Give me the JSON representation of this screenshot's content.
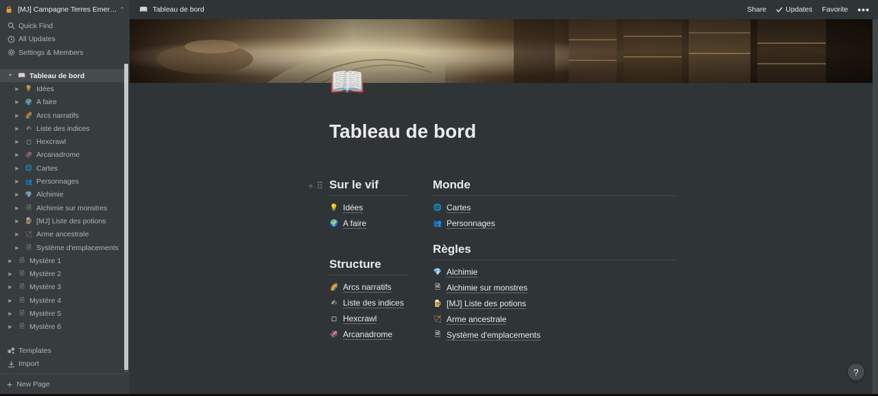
{
  "sidebar": {
    "workspace_name": "[MJ] Campagne Terres Emer…",
    "links": [
      {
        "icon": "search-icon",
        "label": "Quick Find"
      },
      {
        "icon": "clock-icon",
        "label": "All Updates"
      },
      {
        "icon": "gear-icon",
        "label": "Settings & Members"
      }
    ],
    "tree": [
      {
        "icon": "📖",
        "label": "Tableau de bord",
        "level": 0,
        "active": true,
        "expanded": true
      },
      {
        "icon": "💡",
        "label": "Idées",
        "level": 1
      },
      {
        "icon": "🌍",
        "label": "A faire",
        "level": 1
      },
      {
        "icon": "🌈",
        "label": "Arcs narratifs",
        "level": 1
      },
      {
        "icon": "✍",
        "label": "Liste des indices",
        "level": 1
      },
      {
        "icon": "◻",
        "label": "Hexcrawl",
        "level": 1
      },
      {
        "icon": "🦑",
        "label": "Arcanadrome",
        "level": 1
      },
      {
        "icon": "🌐",
        "label": "Cartes",
        "level": 1
      },
      {
        "icon": "👥",
        "label": "Personnages",
        "level": 1
      },
      {
        "icon": "💎",
        "label": "Alchimie",
        "level": 1
      },
      {
        "icon": "🗎",
        "label": "Alchimie sur monstres",
        "level": 1
      },
      {
        "icon": "🍺",
        "label": "[MJ] Liste des potions",
        "level": 1
      },
      {
        "icon": "🏹",
        "label": "Arme ancestrale",
        "level": 1
      },
      {
        "icon": "🗎",
        "label": "Système d'emplacements",
        "level": 1
      },
      {
        "icon": "🗎",
        "label": "Mystère 1",
        "level": 0
      },
      {
        "icon": "🗎",
        "label": "Mystère 2",
        "level": 0
      },
      {
        "icon": "🗎",
        "label": "Mystère 3",
        "level": 0
      },
      {
        "icon": "🗎",
        "label": "Mystère 4",
        "level": 0
      },
      {
        "icon": "🗎",
        "label": "Mystère 5",
        "level": 0
      },
      {
        "icon": "🗎",
        "label": "Mystère 6",
        "level": 0
      }
    ],
    "bottom_links": [
      {
        "icon": "templates-icon",
        "label": "Templates"
      },
      {
        "icon": "import-icon",
        "label": "Import"
      }
    ],
    "new_page_label": "New Page"
  },
  "topbar": {
    "breadcrumb_icon": "📖",
    "breadcrumb": "Tableau de bord",
    "share": "Share",
    "updates": "Updates",
    "favorite": "Favorite",
    "more": "•••"
  },
  "page": {
    "icon": "📖",
    "title": "Tableau de bord"
  },
  "sections": {
    "sur_le_vif": {
      "heading": "Sur le vif",
      "links": [
        {
          "icon": "💡",
          "label": "Idées"
        },
        {
          "icon": "🌍",
          "label": "A faire"
        }
      ]
    },
    "structure": {
      "heading": "Structure",
      "links": [
        {
          "icon": "🌈",
          "label": "Arcs narratifs"
        },
        {
          "icon": "✍",
          "label": "Liste des indices"
        },
        {
          "icon": "◻",
          "label": "Hexcrawl"
        },
        {
          "icon": "🦑",
          "label": "Arcanadrome"
        }
      ]
    },
    "monde": {
      "heading": "Monde",
      "links": [
        {
          "icon": "🌐",
          "label": "Cartes"
        },
        {
          "icon": "👥",
          "label": "Personnages"
        }
      ]
    },
    "regles": {
      "heading": "Règles",
      "links": [
        {
          "icon": "💎",
          "label": "Alchimie"
        },
        {
          "icon": "🗎",
          "label": "Alchimie sur monstres"
        },
        {
          "icon": "🍺",
          "label": "[MJ] Liste des potions"
        },
        {
          "icon": "🏹",
          "label": "Arme ancestrale"
        },
        {
          "icon": "🗎",
          "label": "Système d'emplacements"
        }
      ]
    }
  },
  "help": {
    "label": "?"
  },
  "colors": {
    "background": "#2f3437",
    "sidebar": "#373c3f",
    "text": "#ebebeb"
  }
}
